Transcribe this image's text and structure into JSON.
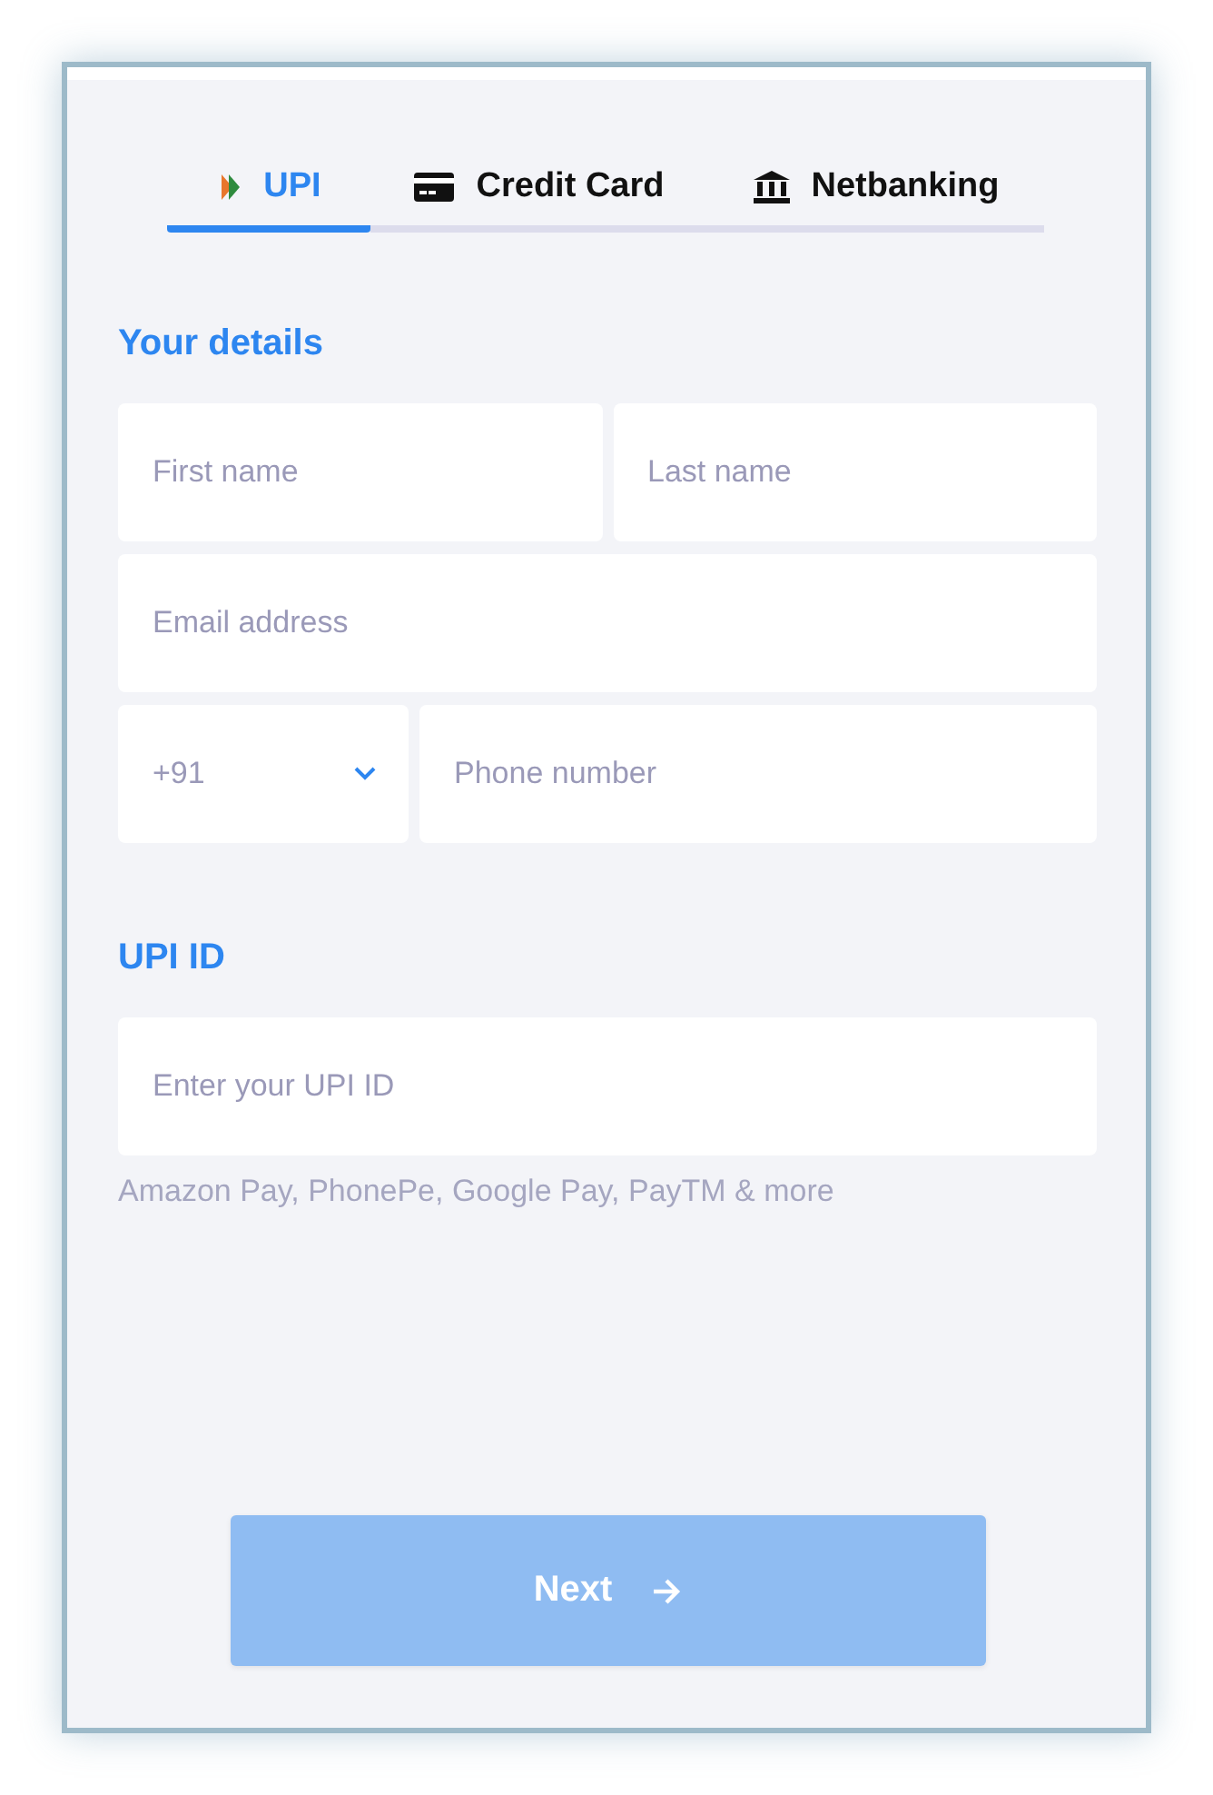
{
  "tabs": [
    {
      "label": "UPI",
      "kind": "upi",
      "selected": true
    },
    {
      "label": "Credit Card",
      "kind": "card",
      "selected": false
    },
    {
      "label": "Netbanking",
      "kind": "bank",
      "selected": false
    }
  ],
  "details": {
    "heading": "Your details",
    "rows": [
      [
        {
          "kind": "text",
          "placeholder": "First name"
        },
        {
          "kind": "text",
          "placeholder": "Last name"
        }
      ],
      [
        {
          "kind": "text",
          "placeholder": "Email address"
        }
      ],
      [
        {
          "kind": "select",
          "value": "+91"
        },
        {
          "kind": "text",
          "placeholder": "Phone number"
        }
      ]
    ]
  },
  "upi": {
    "heading": "UPI ID",
    "placeholder": "Enter your UPI ID",
    "hint": "Amazon Pay, PhonePe, Google Pay, PayTM & more"
  },
  "next_button": {
    "label": "Next",
    "disabled": true
  }
}
